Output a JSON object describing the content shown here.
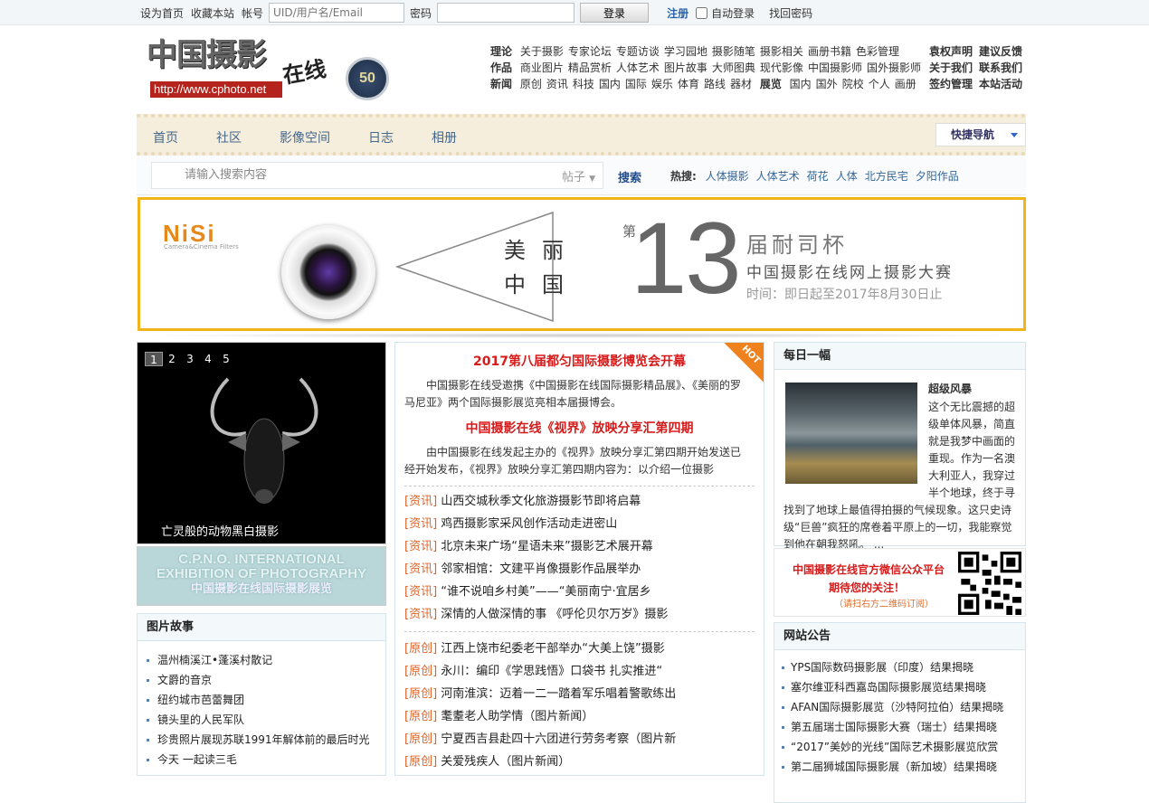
{
  "topbar": {
    "set_home": "设为首页",
    "bookmark": "收藏本站",
    "account_label": "帐号",
    "account_placeholder": "UID/用户名/Email",
    "password_label": "密码",
    "login": "登录",
    "register": "注册",
    "auto_login": "自动登录",
    "find_password": "找回密码"
  },
  "header": {
    "logo_text": "中国摄影",
    "logo_sub": "在线",
    "logo_url": "http://www.cphoto.net",
    "badge": "50",
    "nav_rows": [
      {
        "head": "理论",
        "items": [
          "关于摄影",
          "专家论坛",
          "专题访谈",
          "学习园地",
          "摄影随笔",
          "摄影相关",
          "画册书籍",
          "色彩管理"
        ]
      },
      {
        "head": "作品",
        "items": [
          "商业图片",
          "精品赏析",
          "人体艺术",
          "图片故事",
          "大师图典",
          "现代影像",
          "中国摄影师",
          "国外摄影师"
        ]
      },
      {
        "head": "新闻",
        "items": [
          "原创",
          "资讯",
          "科技",
          "国内",
          "国际",
          "娱乐",
          "体育",
          "路线",
          "器材"
        ],
        "head2": "展览",
        "items2": [
          "国内",
          "国外",
          "院校",
          "个人",
          "画册"
        ]
      }
    ],
    "right_rows": [
      [
        "袁权声明",
        "建议反馈"
      ],
      [
        "关于我们",
        "联系我们"
      ],
      [
        "签约管理",
        "本站活动"
      ]
    ]
  },
  "mainnav": {
    "items": [
      "首页",
      "社区",
      "影像空间",
      "日志",
      "相册"
    ],
    "quick": "快捷导航"
  },
  "search": {
    "placeholder": "请输入搜索内容",
    "type": "帖子",
    "button": "搜索",
    "hot_label": "热搜:",
    "hot": [
      "人体摄影",
      "人体艺术",
      "荷花",
      "人体",
      "北方民宅",
      "夕阳作品"
    ]
  },
  "banner": {
    "brand": "NiSi",
    "brand_sub": "Camera&Cinema Filters",
    "line1": "美丽",
    "line2": "中国",
    "di": "第",
    "num": "13",
    "cup": "届耐司杯",
    "contest": "中国摄影在线网上摄影大赛",
    "time": "时间：即日起至2017年8月30日止"
  },
  "slideshow": {
    "pages": [
      "1",
      "2",
      "3",
      "4",
      "5"
    ],
    "caption": "亡灵般的动物黑白摄影"
  },
  "cpno": {
    "line1": "C.P.N.O. INTERNATIONAL",
    "line2": "EXHIBITION OF PHOTOGRAPHY",
    "line3": "中国摄影在线国际摄影展览"
  },
  "story": {
    "title": "图片故事",
    "items": [
      "温州楠溪江•蓬溪村散记",
      "文爵的音京",
      "纽约城市芭蕾舞团",
      "镜头里的人民军队",
      "珍贵照片展现苏联1991年解体前的最后时光",
      "今天 一起读三毛"
    ]
  },
  "middle": {
    "hot": "HOT",
    "headline1": "2017第八届都匀国际摄影博览会开幕",
    "summary1": "中国摄影在线受邀携《中国摄影在线国际摄影精品展》、《美丽的罗马尼亚》两个国际摄影展览亮相本届摄博会。",
    "headline2": "中国摄影在线《视界》放映分享汇第四期",
    "summary2": "由中国摄影在线发起主办的《视界》放映分享汇第四期开始发送已经开始发布，《视界》放映分享汇第四期内容为：以介绍一位摄影",
    "news1": [
      {
        "tag": "[资讯]",
        "text": "山西交城秋季文化旅游摄影节即将启幕"
      },
      {
        "tag": "[资讯]",
        "text": "鸡西摄影家采风创作活动走进密山"
      },
      {
        "tag": "[资讯]",
        "text": "北京未来广场“星语未来”摄影艺术展开幕"
      },
      {
        "tag": "[资讯]",
        "text": "邻家相馆：文建平肖像摄影作品展举办"
      },
      {
        "tag": "[资讯]",
        "text": "“谁不说咱乡村美”——“美丽南宁·宜居乡"
      },
      {
        "tag": "[资讯]",
        "text": "深情的人做深情的事 《呼伦贝尔万岁》摄影"
      }
    ],
    "news2": [
      {
        "tag": "[原创]",
        "text": "江西上饶市纪委老干部举办“大美上饶”摄影"
      },
      {
        "tag": "[原创]",
        "text": "永川：编印《学思践悟》口袋书 扎实推进“"
      },
      {
        "tag": "[原创]",
        "text": "河南淮滨：迈着一二一踏着军乐唱着警歌练出"
      },
      {
        "tag": "[原创]",
        "text": "耄耋老人助学情（图片新闻）"
      },
      {
        "tag": "[原创]",
        "text": "宁夏西吉县赴四十六团进行劳务考察（图片新"
      },
      {
        "tag": "[原创]",
        "text": "关爱残疾人（图片新闻）"
      }
    ]
  },
  "daily": {
    "title": "每日一幅",
    "photo_title": "超级风暴",
    "text": "这个无比震撼的超级单体风暴，简直就是我梦中画面的重现。作为一名澳大利亚人，我穿过半个地球，终于寻找到了地球上最值得拍摄的气候现象。这只史诗级“巨兽”疯狂的席卷着平原上的一切，我能察觉到他在朝我怒吼。 ..."
  },
  "wechat": {
    "line1": "中国摄影在线官方微信公众平台",
    "line2": "期待您的关注！",
    "line3": "（请扫右方二维码订阅）"
  },
  "notice": {
    "title": "网站公告",
    "items": [
      "YPS国际数码摄影展（印度）结果揭晓",
      "塞尔维亚科西嘉岛国际摄影展览结果揭晓",
      "AFAN国际摄影展览（沙特阿拉伯）结果揭晓",
      "第五届瑞士国际摄影大赛（瑞士）结果揭晓",
      "“2017”美妙的光线”国际艺术摄影展览欣赏",
      "第二届狮城国际摄影展（新加坡）结果揭晓"
    ]
  },
  "colors": {
    "accent": "#d71a1a",
    "nav": "#44678c",
    "banner_border": "#f2b41a",
    "tag": "#e0642a"
  }
}
